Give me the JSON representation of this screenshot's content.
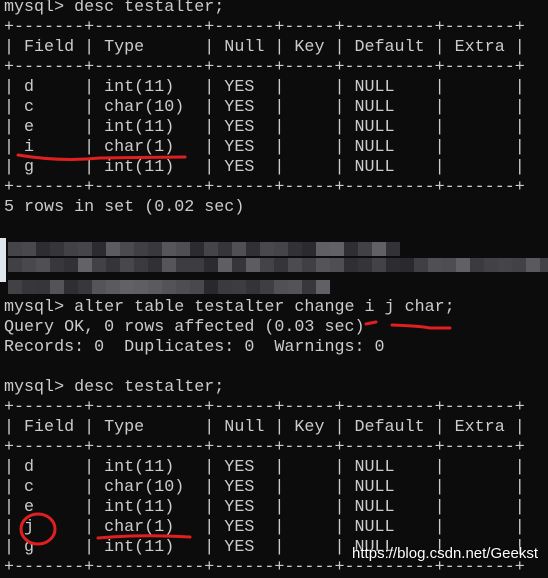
{
  "terminal": {
    "lines": [
      "mysql> desc testalter;",
      "+-------+-----------+------+-----+---------+-------+",
      "| Field | Type      | Null | Key | Default | Extra |",
      "+-------+-----------+------+-----+---------+-------+",
      "| d     | int(11)   | YES  |     | NULL    |       |",
      "| c     | char(10)  | YES  |     | NULL    |       |",
      "| e     | int(11)   | YES  |     | NULL    |       |",
      "| i     | char(1)   | YES  |     | NULL    |       |",
      "| g     | int(11)   | YES  |     | NULL    |       |",
      "+-------+-----------+------+-----+---------+-------+",
      "5 rows in set (0.02 sec)",
      "",
      "",
      "",
      "",
      "mysql> alter table testalter change i j char;",
      "Query OK, 0 rows affected (0.03 sec)",
      "Records: 0  Duplicates: 0  Warnings: 0",
      "",
      "mysql> desc testalter;",
      "+-------+-----------+------+-----+---------+-------+",
      "| Field | Type      | Null | Key | Default | Extra |",
      "+-------+-----------+------+-----+---------+-------+",
      "| d     | int(11)   | YES  |     | NULL    |       |",
      "| c     | char(10)  | YES  |     | NULL    |       |",
      "| e     | int(11)   | YES  |     | NULL    |       |",
      "| j     | char(1)   | YES  |     | NULL    |       |",
      "| g     | int(11)   | YES  |     | NULL    |       |",
      "+-------+-----------+------+-----+---------+-------+"
    ]
  },
  "watermark": "https://blog.csdn.net/Geekst",
  "colors": {
    "background": "#0c0c0c",
    "text": "#cccccc",
    "annotation": "#e02020"
  }
}
